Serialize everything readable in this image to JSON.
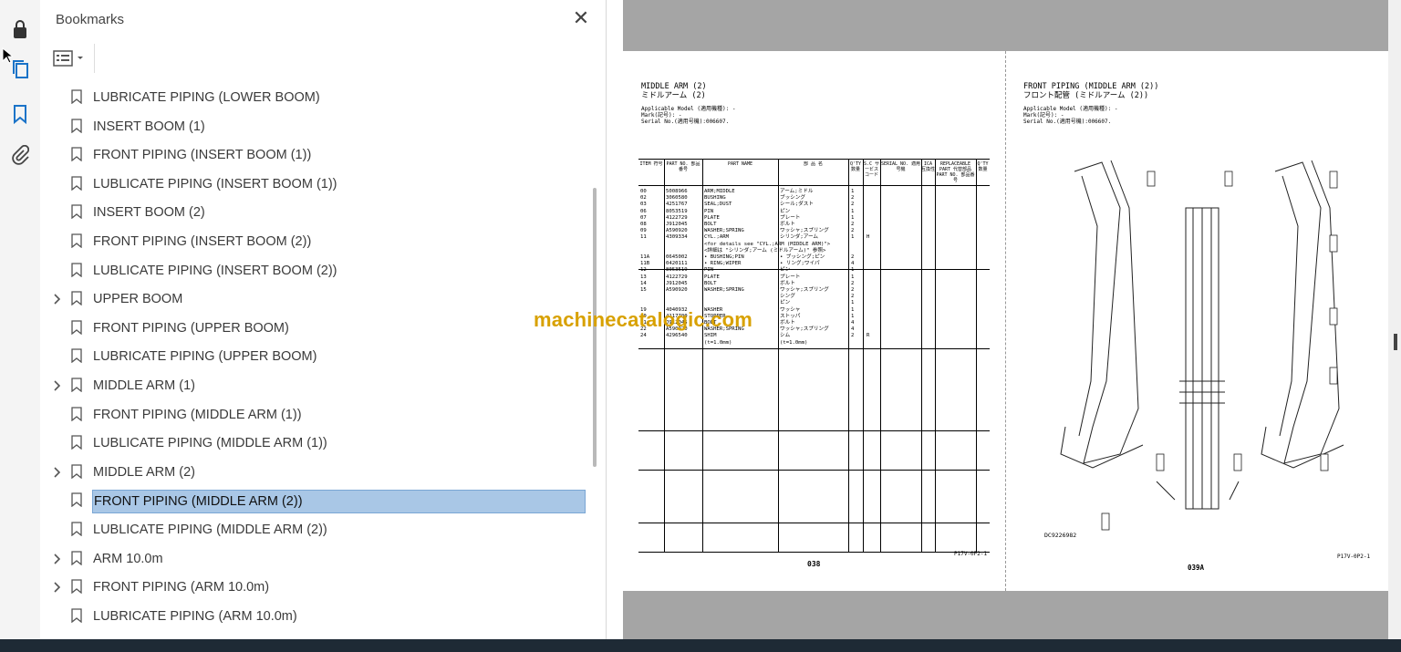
{
  "panel": {
    "title": "Bookmarks",
    "close_glyph": "✕"
  },
  "bookmarks": [
    {
      "label": "LUBRICATE PIPING (LOWER BOOM)",
      "expandable": false
    },
    {
      "label": "INSERT BOOM (1)",
      "expandable": false
    },
    {
      "label": "FRONT PIPING (INSERT BOOM (1))",
      "expandable": false
    },
    {
      "label": "LUBLICATE PIPING (INSERT BOOM (1))",
      "expandable": false
    },
    {
      "label": "INSERT BOOM (2)",
      "expandable": false
    },
    {
      "label": "FRONT PIPING (INSERT BOOM (2))",
      "expandable": false
    },
    {
      "label": "LUBLICATE PIPING (INSERT BOOM (2))",
      "expandable": false
    },
    {
      "label": "UPPER BOOM",
      "expandable": true
    },
    {
      "label": "FRONT PIPING (UPPER BOOM)",
      "expandable": false
    },
    {
      "label": "LUBRICATE PIPING (UPPER BOOM)",
      "expandable": false
    },
    {
      "label": "MIDDLE ARM (1)",
      "expandable": true
    },
    {
      "label": "FRONT PIPING (MIDDLE ARM (1))",
      "expandable": false
    },
    {
      "label": "LUBLICATE PIPING (MIDDLE ARM (1))",
      "expandable": false
    },
    {
      "label": "MIDDLE ARM (2)",
      "expandable": true
    },
    {
      "label": "FRONT PIPING (MIDDLE ARM (2))",
      "expandable": false,
      "selected": true
    },
    {
      "label": "LUBLICATE PIPING (MIDDLE ARM (2))",
      "expandable": false
    },
    {
      "label": "ARM 10.0m",
      "expandable": true
    },
    {
      "label": "FRONT PIPING (ARM 10.0m)",
      "expandable": true
    },
    {
      "label": "LUBRICATE PIPING (ARM 10.0m)",
      "expandable": false
    }
  ],
  "watermark": "machinecatalogic.com",
  "doc": {
    "left": {
      "title_en": "MIDDLE ARM (2)",
      "title_jp": "ミドルアーム (2)",
      "applicable": "Applicable Model (適用機種): -",
      "mark": "Mark(記号): -",
      "serial": "Serial No.(適用号機):006607.",
      "headers": [
        "ITEM 符号",
        "PART NO. 部品番号",
        "PART NAME",
        "部 品 名",
        "Q'TY 数量",
        "S.C サービスコード",
        "SERIAL NO. 適用号機",
        "ICA 互換性",
        "REPLACEABLE PART 代替部品 PART NO. 部品番号",
        "Q'TY 数量"
      ],
      "rows": [
        [
          "00",
          "5008966",
          "ARM;MIDDLE",
          "アーム;ミドル",
          "1",
          ""
        ],
        [
          "02",
          "3060580",
          "BUSHING",
          "ブッシング",
          "2",
          ""
        ],
        [
          "03",
          "4251767",
          "SEAL;DUST",
          "シール;ダスト",
          "2",
          ""
        ],
        [
          "06",
          "8053519",
          "PIN",
          "ピン",
          "1",
          ""
        ],
        [
          "07",
          "4122729",
          "PLATE",
          "プレート",
          "1",
          ""
        ],
        [
          "08",
          "J912045",
          "BOLT",
          "ボルト",
          "2",
          ""
        ],
        [
          "09",
          "A590920",
          "WASHER;SPRING",
          "ワッシャ;スプリング",
          "2",
          ""
        ],
        [
          "11",
          "4309334",
          "CYL.;ARM",
          "シリンダ;アーム",
          "1",
          "H"
        ],
        [
          "",
          "",
          "<for details see \"CYL.;ARM (MIDDLE ARM)\">",
          "",
          "",
          ""
        ],
        [
          "",
          "",
          "<詳細は \"シリンダ;アーム (ミドルアーム)\" 参照>",
          "",
          "",
          ""
        ],
        [
          "11A",
          "0645002",
          "• BUSHING;PIN",
          "• ブッシング;ピン",
          "2",
          ""
        ],
        [
          "11B",
          "0420111",
          "• RING;WIPER",
          "• リング;ワイパ",
          "4",
          ""
        ],
        [
          "12",
          "8053519",
          "PIN",
          "ピン",
          "1",
          ""
        ],
        [
          "13",
          "4122729",
          "PLATE",
          "プレート",
          "1",
          ""
        ],
        [
          "14",
          "J912045",
          "BOLT",
          "ボルト",
          "2",
          ""
        ],
        [
          "15",
          "A590920",
          "WASHER;SPRING",
          "ワッシャ;スプリング",
          "2",
          ""
        ],
        [
          "",
          "",
          "",
          "シング",
          "2",
          ""
        ],
        [
          "",
          "",
          "",
          "ピン",
          "1",
          ""
        ],
        [
          "19",
          "4040932",
          "WASHER",
          "ワッシャ",
          "1",
          ""
        ],
        [
          "20",
          "4117700",
          "STOPPER",
          "ストッパ",
          "1",
          ""
        ],
        [
          "21",
          "J912045",
          "BOLT",
          "ボルト",
          "4",
          ""
        ],
        [
          "22",
          "A590920",
          "WASHER;SPRING",
          "ワッシャ;スプリング",
          "4",
          ""
        ],
        [
          "24",
          "4296540",
          "SHIM",
          "シム",
          "2",
          "R"
        ],
        [
          "",
          "",
          "(t=1.0mm)",
          "(t=1.0mm)",
          "",
          ""
        ]
      ],
      "page_no": "038",
      "code": "P17V-0P2-1"
    },
    "right": {
      "title_en": "FRONT PIPING (MIDDLE ARM (2))",
      "title_jp": "フロント配管 (ミドルアーム (2))",
      "applicable": "Applicable Model (適用機種): -",
      "mark": "Mark(記号): -",
      "serial": "Serial No.(適用号機):006607.",
      "drawing_no": "DC9226982",
      "page_no": "039A",
      "code": "P17V-0P2-1"
    }
  },
  "icons": {
    "lock": "lock-icon",
    "pages": "pages-icon",
    "bookmark": "bookmark-icon",
    "attachment": "paperclip-icon"
  }
}
